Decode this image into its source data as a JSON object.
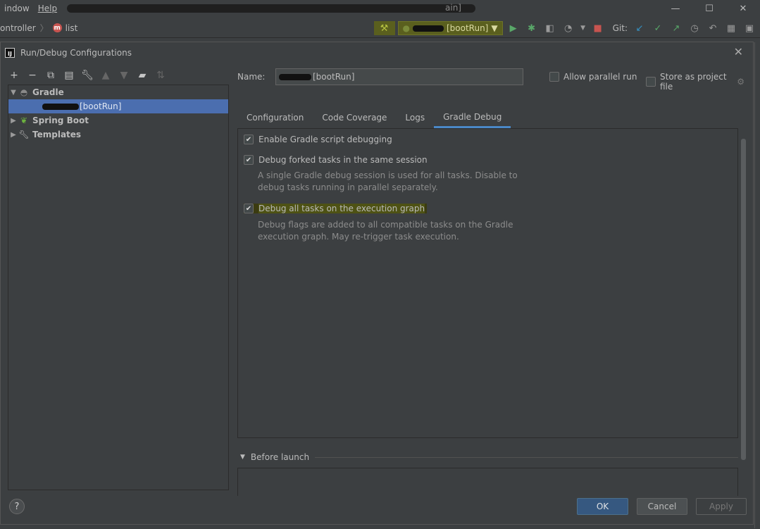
{
  "menubar": {
    "items": [
      "indow",
      "Help"
    ],
    "redacted_suffix": "ain]"
  },
  "window_controls": {
    "minimize": "—",
    "maximize": "☐",
    "close": "✕"
  },
  "navbar": {
    "crumb1": "ontroller",
    "sep": "〉",
    "m_icon": "m",
    "crumb2": "list"
  },
  "toolbar": {
    "run_config": "[bootRun]",
    "git_label": "Git:"
  },
  "dialog": {
    "title": "Run/Debug Configurations",
    "name_label": "Name:",
    "name_value": "[bootRun]",
    "allow_parallel": "Allow parallel run",
    "store_project": "Store as project file",
    "tabs": [
      "Configuration",
      "Code Coverage",
      "Logs",
      "Gradle Debug"
    ],
    "active_tab": "Gradle Debug",
    "options": [
      {
        "label": "Enable Gradle script debugging",
        "checked": true
      },
      {
        "label": "Debug forked tasks in the same session",
        "checked": true,
        "desc": "A single Gradle debug session is used for all tasks. Disable to debug tasks running in parallel separately."
      },
      {
        "label": "Debug all tasks on the execution graph",
        "checked": true,
        "desc": "Debug flags are added to all compatible tasks on the Gradle execution graph. May re-trigger task execution."
      }
    ],
    "before_launch": "Before launch",
    "buttons": {
      "ok": "OK",
      "cancel": "Cancel",
      "apply": "Apply",
      "help": "?"
    }
  },
  "tree": {
    "gradle": "Gradle",
    "gradle_child": "[bootRun]",
    "spring_boot": "Spring Boot",
    "templates": "Templates"
  },
  "colors": {
    "accent": "#4b6eaf",
    "tab_underline": "#4a88c7",
    "ok_button": "#365880",
    "highlight": "#4e5214"
  }
}
